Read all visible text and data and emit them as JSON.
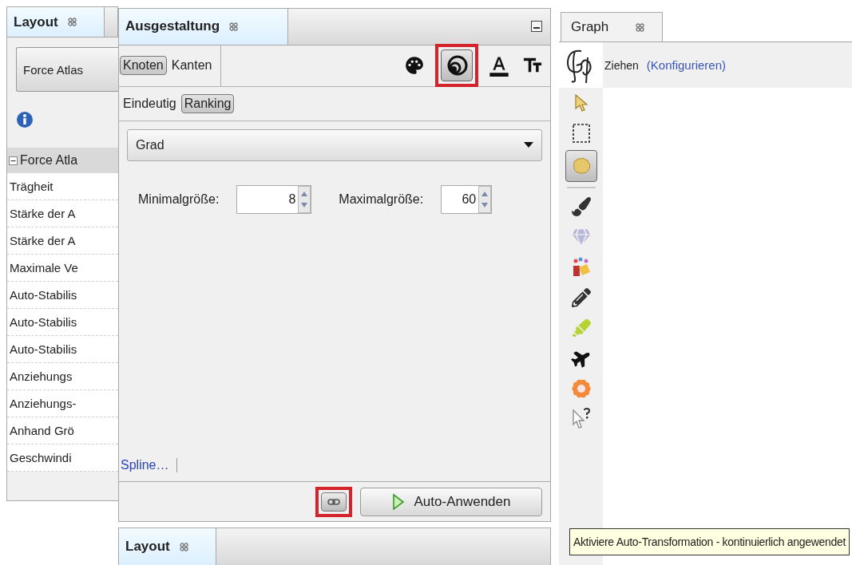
{
  "layout_panel": {
    "tab_title": "Layout",
    "layout_button": "Force Atlas",
    "property_group": {
      "label": "Force Atla",
      "expanded": true,
      "rows": [
        "Trägheit",
        "Stärke der A",
        "Stärke der A",
        "Maximale Ve",
        "Auto-Stabilis",
        "Auto-Stabilis",
        "Auto-Stabilis",
        "Anziehungs",
        "Anziehungs-",
        "Anhand Grö",
        "Geschwindi"
      ]
    }
  },
  "style_panel": {
    "tab_title": "Ausgestaltung",
    "target_tabs": [
      {
        "label": "Knoten",
        "selected": true
      },
      {
        "label": "Kanten",
        "selected": false
      }
    ],
    "tools": [
      {
        "kind": "color",
        "selected": false,
        "highlighted": false
      },
      {
        "kind": "size",
        "selected": true,
        "highlighted": true
      },
      {
        "kind": "label_color",
        "selected": false,
        "highlighted": false
      },
      {
        "kind": "label_size",
        "selected": false,
        "highlighted": false
      }
    ],
    "mode_tabs": [
      {
        "label": "Eindeutig",
        "selected": false
      },
      {
        "label": "Ranking",
        "selected": true
      }
    ],
    "attribute": "Grad",
    "min_label": "Minimalgröße:",
    "min_value": "8",
    "max_label": "Maximalgröße:",
    "max_value": "60",
    "spline_link": "Spline…",
    "auto_transform_toggle": {
      "highlighted": true
    },
    "apply_button": "Auto-Anwenden"
  },
  "bottom_tabs": [
    {
      "label": "Layout"
    }
  ],
  "graph_panel": {
    "tab_title": "Graph",
    "tool_label": "Ziehen",
    "configure_link": "(Konfigurieren)",
    "tools": [
      {
        "kind": "select",
        "selected": false
      },
      {
        "kind": "rect_select",
        "selected": false
      },
      {
        "kind": "drag",
        "selected": true
      },
      {
        "kind": "brush",
        "selected": false
      },
      {
        "kind": "diamond",
        "selected": false
      },
      {
        "kind": "painter",
        "selected": false
      },
      {
        "kind": "pencil",
        "selected": false
      },
      {
        "kind": "highlighter",
        "selected": false
      },
      {
        "kind": "plane",
        "selected": false
      },
      {
        "kind": "flower",
        "selected": false
      },
      {
        "kind": "help",
        "selected": false
      }
    ]
  },
  "tooltip": "Aktiviere Auto-Transformation - kontinuierlich angewendet"
}
